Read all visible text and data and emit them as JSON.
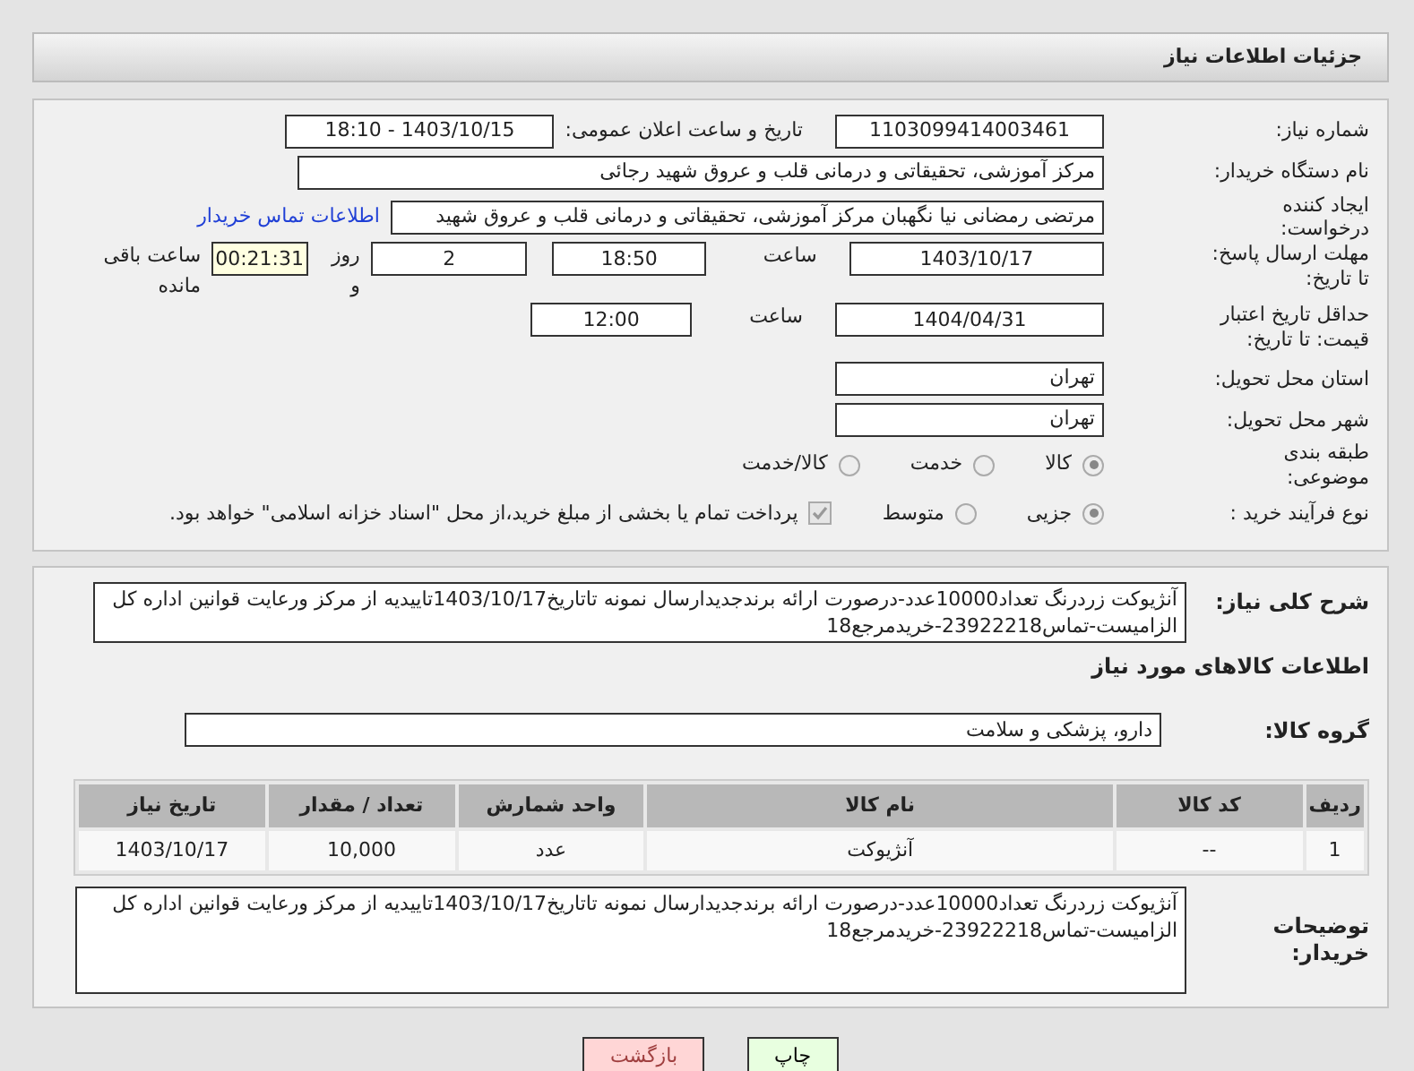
{
  "header": {
    "title": "جزئیات اطلاعات نیاز"
  },
  "need_number": {
    "label": "شماره نیاز:",
    "value": "1103099414003461"
  },
  "announce": {
    "label": "تاریخ و ساعت اعلان عمومی:",
    "value": "1403/10/15 - 18:10"
  },
  "buyer_org": {
    "label": "نام دستگاه خریدار:",
    "value": "مرکز آموزشی، تحقیقاتی و درمانی قلب و عروق شهید رجائی"
  },
  "requester": {
    "label": "ایجاد کننده درخواست:",
    "value": "مرتضی رمضانی نیا نگهبان مرکز آموزشی، تحقیقاتی و درمانی قلب و عروق شهید",
    "link": "اطلاعات تماس خریدار"
  },
  "deadline": {
    "label": "مهلت ارسال پاسخ: تا تاریخ:",
    "date": "1403/10/17",
    "time_label": "ساعت",
    "time": "18:50",
    "days": "2",
    "days_label": "روز و",
    "remaining": "00:21:31",
    "remaining_label": "ساعت باقی مانده"
  },
  "validity": {
    "label": "حداقل تاریخ اعتبار قیمت: تا تاریخ:",
    "date": "1404/04/31",
    "time_label": "ساعت",
    "time": "12:00"
  },
  "province": {
    "label": "استان محل تحویل:",
    "value": "تهران"
  },
  "city": {
    "label": "شهر محل تحویل:",
    "value": "تهران"
  },
  "category": {
    "label": "طبقه بندی موضوعی:",
    "options": [
      {
        "label": "کالا",
        "selected": true
      },
      {
        "label": "خدمت",
        "selected": false
      },
      {
        "label": "کالا/خدمت",
        "selected": false
      }
    ]
  },
  "process": {
    "label": "نوع فرآیند خرید :",
    "options": [
      {
        "label": "جزیی",
        "selected": true
      },
      {
        "label": "متوسط",
        "selected": false
      }
    ],
    "payment": {
      "checked": true,
      "text": "پرداخت تمام یا بخشی از مبلغ خرید،از محل \"اسناد خزانه اسلامی\" خواهد بود."
    }
  },
  "description": {
    "label": "شرح کلی نیاز:",
    "value": "آنژیوکت زردرنگ تعداد10000عدد-درصورت ارائه برندجدیدارسال نمونه تاتاریخ1403/10/17تاییدیه از مرکز ورعایت قوانین اداره کل الزامیست-تماس23922218-خریدمرجع18"
  },
  "goods": {
    "title": "اطلاعات کالاهای مورد نیاز",
    "group_label": "گروه کالا:",
    "group": "دارو، پزشکی و سلامت"
  },
  "table": {
    "columns": [
      "ردیف",
      "کد کالا",
      "نام کالا",
      "واحد شمارش",
      "تعداد / مقدار",
      "تاریخ نیاز"
    ],
    "rows": [
      [
        "1",
        "--",
        "آنژیوکت",
        "عدد",
        "10,000",
        "1403/10/17"
      ]
    ]
  },
  "buyer_notes": {
    "label": "توضیحات خریدار:",
    "value": "آنژیوکت زردرنگ تعداد10000عدد-درصورت ارائه برندجدیدارسال نمونه تاتاریخ1403/10/17تاییدیه از مرکز ورعایت قوانین اداره کل الزامیست-تماس23922218-خریدمرجع18"
  },
  "buttons": [
    {
      "label": "چاپ",
      "kind": "print"
    },
    {
      "label": "بازگشت",
      "kind": "back"
    }
  ]
}
